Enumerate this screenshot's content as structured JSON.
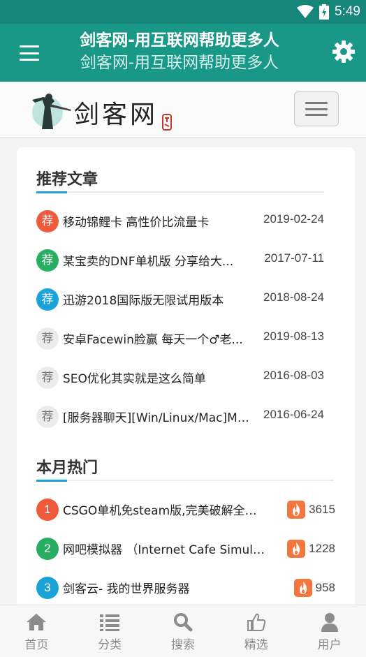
{
  "status_bar": {
    "time": "5:49"
  },
  "header": {
    "title": "剑客网-用互联网帮助更多人",
    "subtitle": "剑客网-用互联网帮助更多人"
  },
  "site": {
    "logo_text": "剑客网"
  },
  "colors": {
    "header": "#199888",
    "accent_blue": "#1aa3d8",
    "badge_red": "#f05a3c",
    "badge_green": "#27ae60",
    "badge_blue": "#1aa3d8",
    "badge_gray": "#ebebeb"
  },
  "recommended": {
    "heading": "推荐文章",
    "badge_text": "荐",
    "items": [
      {
        "title": "移动锦鲤卡 高性价比流量卡",
        "date": "2019-02-24",
        "badge": "red"
      },
      {
        "title": "某宝卖的DNF单机版 分享给大...",
        "date": "2017-07-11",
        "badge": "green"
      },
      {
        "title": "迅游2018国际版无限试用版本",
        "date": "2018-08-24",
        "badge": "blue"
      },
      {
        "title": "安卓Facewin脸赢 每天一个♂老...",
        "date": "2019-08-13",
        "badge": "gray"
      },
      {
        "title": "SEO优化其实就是这么简单",
        "date": "2016-08-03",
        "badge": "gray"
      },
      {
        "title": "[服务器聊天][Win/Linux/Mac]Mi...",
        "date": "2016-06-24",
        "badge": "gray"
      }
    ]
  },
  "hot": {
    "heading": "本月热门",
    "items": [
      {
        "rank": "1",
        "title": "CSGO单机免steam版,完美破解全仓...",
        "count": "3615",
        "badge": "red"
      },
      {
        "rank": "2",
        "title": "网吧模拟器 （Internet Cafe Simulat...",
        "count": "1228",
        "badge": "green"
      },
      {
        "rank": "3",
        "title": "剑客云- 我的世界服务器",
        "count": "958",
        "badge": "blue"
      }
    ]
  },
  "tabs": [
    {
      "label": "首页",
      "icon": "home-icon"
    },
    {
      "label": "分类",
      "icon": "list-icon"
    },
    {
      "label": "搜索",
      "icon": "search-icon"
    },
    {
      "label": "精选",
      "icon": "thumbs-up-icon"
    },
    {
      "label": "用户",
      "icon": "user-icon"
    }
  ]
}
